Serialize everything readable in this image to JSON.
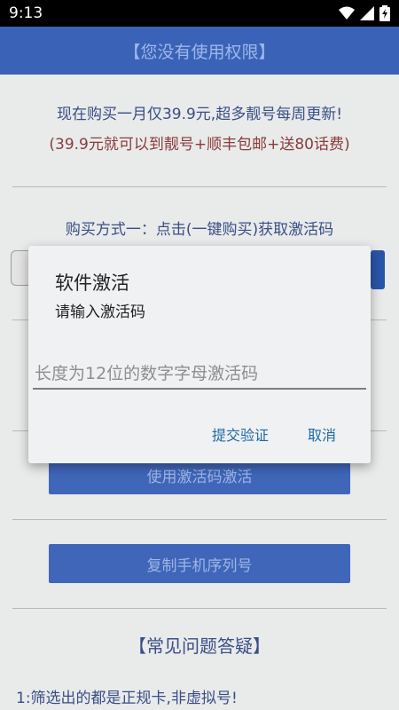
{
  "status_bar": {
    "time": "9:13"
  },
  "header": {
    "title": "【您没有使用权限】"
  },
  "promo": {
    "line1": "现在购买一月仅39.9元,超多靓号每周更新!",
    "line2": "(39.9元就可以到靓号+顺丰包邮+送80话费)"
  },
  "purchase": {
    "method1": "购买方式一：点击(一键购买)获取激活码"
  },
  "buttons": {
    "activate": "使用激活码激活",
    "copy_serial": "复制手机序列号"
  },
  "faq": {
    "title": "【常见问题答疑】",
    "item1": "1:筛选出的都是正规卡,非虚拟号!"
  },
  "dialog": {
    "title": "软件激活",
    "message": "请输入激活码",
    "input_placeholder": "长度为12位的数字字母激活码",
    "submit": "提交验证",
    "cancel": "取消"
  },
  "colors": {
    "header_bg": "#3a63b8",
    "link_text": "#1c6aa6",
    "price_text": "#8a3b3b"
  }
}
